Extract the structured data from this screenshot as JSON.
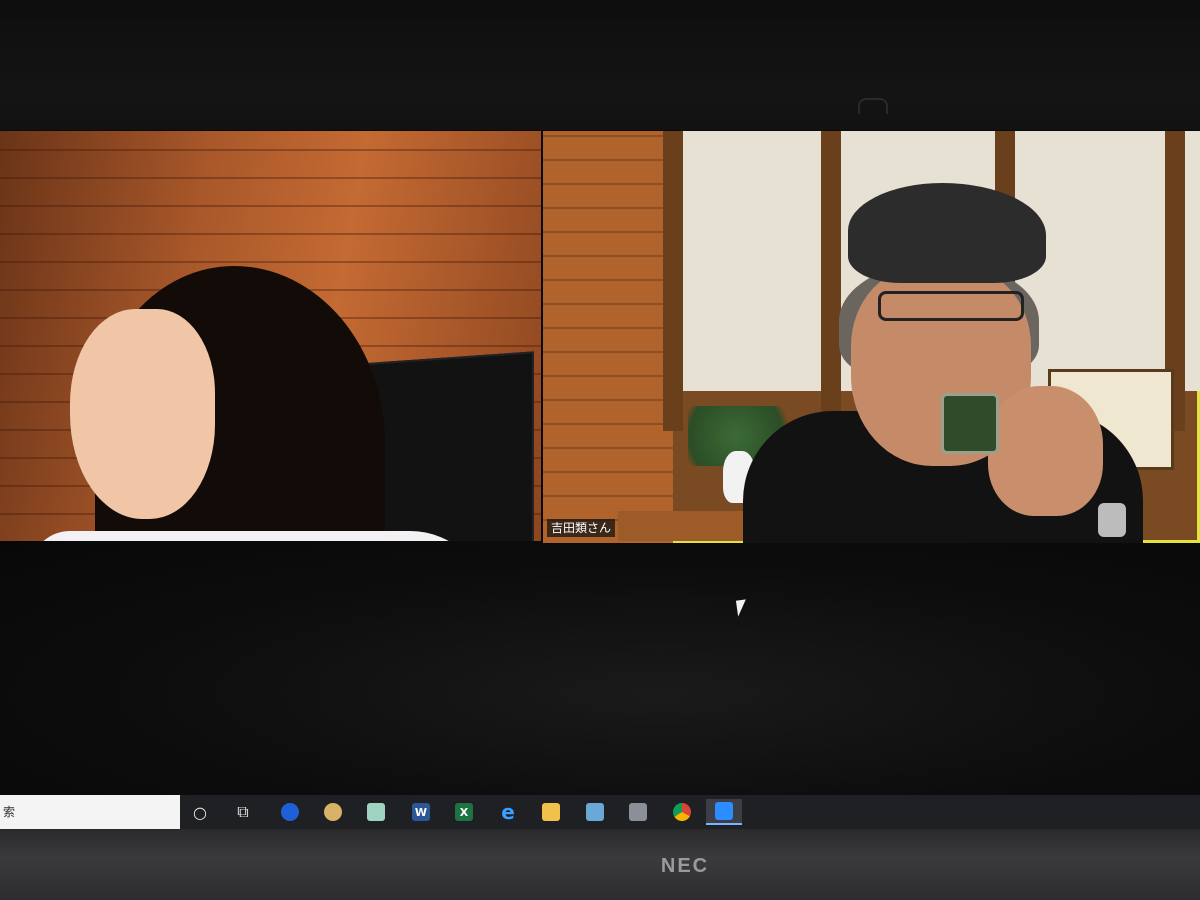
{
  "meeting": {
    "participants": [
      {
        "name_label": ""
      },
      {
        "name_label": "吉田類さん"
      }
    ]
  },
  "taskbar": {
    "search_text": "索",
    "apps": [
      {
        "name": "cortana-icon",
        "glyph": "○"
      },
      {
        "name": "task-view-icon",
        "glyph": "⧉"
      },
      {
        "name": "app-blue-icon",
        "glyph": "◎"
      },
      {
        "name": "paint-icon",
        "glyph": "🎨"
      },
      {
        "name": "notes-icon",
        "glyph": "▰"
      },
      {
        "name": "word-icon",
        "glyph": "W"
      },
      {
        "name": "excel-icon",
        "glyph": "X"
      },
      {
        "name": "internet-explorer-icon",
        "glyph": "e"
      },
      {
        "name": "file-explorer-icon",
        "glyph": "▬"
      },
      {
        "name": "calculator-icon",
        "glyph": "▦"
      },
      {
        "name": "camera-icon",
        "glyph": "◉"
      },
      {
        "name": "chrome-icon",
        "glyph": "◍"
      },
      {
        "name": "zoom-icon",
        "glyph": "▶"
      }
    ],
    "active_app": "zoom-icon"
  },
  "device": {
    "brand_logo": "NEC"
  },
  "colors": {
    "active_speaker_border": "#e3e23f",
    "taskbar": "#1e2024"
  }
}
